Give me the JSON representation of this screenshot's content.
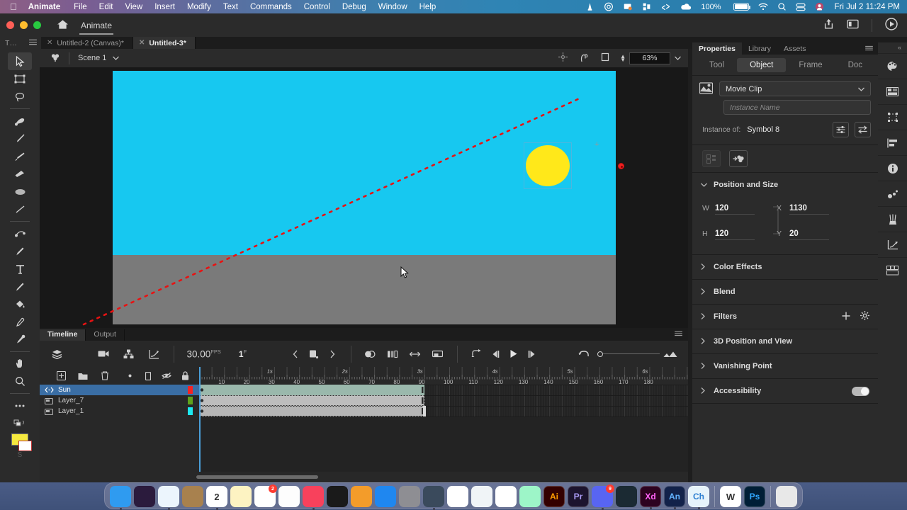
{
  "macbar": {
    "apple": "apple-logo",
    "menus": [
      "Animate",
      "File",
      "Edit",
      "View",
      "Insert",
      "Modify",
      "Text",
      "Commands",
      "Control",
      "Debug",
      "Window",
      "Help"
    ],
    "status_icons": [
      "vlc-icon",
      "creative-cloud-icon",
      "screenshot-icon",
      "shortcuts-icon",
      "dropbox-icon",
      "cloud-icon"
    ],
    "battery_percent": "100%",
    "right_icons": [
      "wifi-icon",
      "spotlight-icon",
      "control-center-icon",
      "user-icon"
    ],
    "clock": "Fri Jul 2  11:24 PM"
  },
  "titlebar": {
    "home_icon": "home-icon",
    "app_name": "Animate",
    "share_icon": "share-icon",
    "layout_icon": "workspace-icon",
    "play_icon": "test-movie-icon"
  },
  "doctabs": {
    "corner_label": "T…",
    "corner_menu": "hamburger-icon",
    "tabs": [
      {
        "label": "Untitled-2 (Canvas)*",
        "active": false
      },
      {
        "label": "Untitled-3*",
        "active": true
      }
    ]
  },
  "toolbar": {
    "tools": [
      {
        "name": "selection-tool",
        "selected": true
      },
      {
        "name": "free-transform-tool",
        "selected": false
      },
      {
        "name": "lasso-tool",
        "selected": false
      },
      {
        "name": "brush-tool",
        "selected": false
      },
      {
        "name": "paint-brush-tool",
        "selected": false
      },
      {
        "name": "fluid-brush-tool",
        "selected": false
      },
      {
        "name": "eraser-tool",
        "selected": false
      },
      {
        "name": "oval-tool",
        "selected": false
      },
      {
        "name": "line-tool",
        "selected": false
      },
      {
        "name": "bone-tool",
        "selected": false
      },
      {
        "name": "pen-tool",
        "selected": false
      },
      {
        "name": "text-tool",
        "selected": false
      },
      {
        "name": "pencil-tool",
        "selected": false
      },
      {
        "name": "paint-bucket-tool",
        "selected": false
      },
      {
        "name": "eyedropper-tool",
        "selected": false
      },
      {
        "name": "width-tool",
        "selected": false
      },
      {
        "name": "hand-tool",
        "selected": false
      },
      {
        "name": "zoom-tool",
        "selected": false
      },
      {
        "name": "more-tools-icon",
        "selected": false
      }
    ],
    "stroke_color": "#ffffff",
    "fill_color": "#f5e93f",
    "footer_label": "S"
  },
  "stagebar": {
    "scene_icon": "scene-icon",
    "scene_name": "Scene 1",
    "scene_chevron": "chevron-down-icon",
    "center_icon": "center-stage-icon",
    "rotate_icon": "rotation-icon",
    "fit_icon": "clip-content-icon",
    "zoom_value": "63%",
    "zoom_chevron": "chevron-down-icon"
  },
  "canvas": {
    "sky_color": "#17c8f0",
    "ground_color": "#7a7a7a",
    "sun_color": "#ffe81a",
    "motion_path_color": "#e81212",
    "registration_point": "registration-point-icon",
    "cursor": "pointer-cursor"
  },
  "timeline": {
    "panel_tabs": [
      {
        "label": "Timeline",
        "active": true
      },
      {
        "label": "Output",
        "active": false
      }
    ],
    "grip": "hamburger-icon",
    "tools_left": [
      "layer-depth-icon",
      "camera-icon",
      "parenting-view-icon",
      "motion-editor-icon"
    ],
    "fps": "30.00",
    "fps_suffix": "FPS",
    "current_frame": "1",
    "frame_suffix": "F",
    "transport": [
      "prev-keyframe-icon",
      "insert-keyframe-icon",
      "next-keyframe-icon",
      "onion-skin-icon",
      "onion-skin-outline-icon",
      "edit-multiple-frames-icon",
      "modify-onion-markers-icon",
      "loop-icon",
      "step-back-icon",
      "play-icon",
      "step-forward-icon"
    ],
    "loop_icon": "loop-playback-icon",
    "zoom_knob": "timeline-zoom-slider",
    "resize_icon": "frame-size-icon",
    "layer_tools": [
      "new-layer-icon",
      "new-folder-icon",
      "delete-layer-icon",
      "show-all-icon",
      "outline-icon",
      "hide-icon",
      "lock-icon"
    ],
    "layers": [
      {
        "name": "Sun",
        "color": "#f52222",
        "selected": true,
        "type": "tween-layer",
        "span_end_frame": 90
      },
      {
        "name": "Layer_7",
        "color": "#5fa31a",
        "selected": false,
        "type": "normal-layer",
        "span_end_frame": 90
      },
      {
        "name": "Layer_1",
        "color": "#1de8f0",
        "selected": false,
        "type": "normal-layer",
        "span_end_frame": 90
      }
    ],
    "ruler": {
      "second_labels": [
        "1s",
        "2s",
        "3s",
        "4s",
        "5s",
        "6s"
      ],
      "frame_labels": [
        "10",
        "20",
        "30",
        "40",
        "50",
        "60",
        "70",
        "80",
        "90",
        "100",
        "110",
        "120",
        "130",
        "140",
        "150",
        "160",
        "170",
        "180"
      ]
    },
    "playhead_frame": 1
  },
  "properties": {
    "panel_tabs": [
      {
        "label": "Properties",
        "active": true
      },
      {
        "label": "Library",
        "active": false
      },
      {
        "label": "Assets",
        "active": false
      }
    ],
    "grip": "hamburger-icon",
    "segments": [
      {
        "label": "Tool",
        "active": false
      },
      {
        "label": "Object",
        "active": true
      },
      {
        "label": "Frame",
        "active": false
      },
      {
        "label": "Doc",
        "active": false
      }
    ],
    "symbol_icon": "movie-clip-icon",
    "symbol_type": "Movie Clip",
    "symbol_chevron": "chevron-down-icon",
    "instance_name_placeholder": "Instance Name",
    "instance_of_label": "Instance of:",
    "instance_of_value": "Symbol 8",
    "instance_buttons": [
      "properties-sliders-icon",
      "swap-symbol-icon"
    ],
    "object_tools": [
      "distribute-icon",
      "apply-asset-icon"
    ],
    "sections": [
      {
        "title": "Position and Size",
        "expanded": true,
        "fields": [
          {
            "label": "W",
            "value": "120"
          },
          {
            "label": "X",
            "value": "1130"
          },
          {
            "label": "H",
            "value": "120"
          },
          {
            "label": "Y",
            "value": "20"
          }
        ],
        "lock_icon": "unlock-icon"
      },
      {
        "title": "Color Effects",
        "expanded": false
      },
      {
        "title": "Blend",
        "expanded": false
      },
      {
        "title": "Filters",
        "expanded": false,
        "actions": [
          "plus-icon",
          "gear-icon"
        ]
      },
      {
        "title": "3D Position and View",
        "expanded": false
      },
      {
        "title": "Vanishing Point",
        "expanded": false
      },
      {
        "title": "Accessibility",
        "expanded": false,
        "toggle": true
      }
    ]
  },
  "rail": {
    "collapse_icon": "collapse-panels-icon",
    "items": [
      "color-panel-icon",
      "library-panel-icon",
      "transform-panel-icon",
      "align-panel-icon",
      "info-panel-icon",
      "swatches-panel-icon",
      "brush-library-icon",
      "motion-editor-icon",
      "frame-picker-icon"
    ]
  },
  "dock": {
    "items": [
      {
        "name": "finder",
        "label": "",
        "color": "#2f9bf0"
      },
      {
        "name": "siri",
        "label": "",
        "color": "#2b1b3d"
      },
      {
        "name": "safari",
        "label": "",
        "color": "#ecf5fd"
      },
      {
        "name": "contacts",
        "label": "",
        "color": "#a8814e"
      },
      {
        "name": "calendar",
        "label": "2",
        "color": "#ffffff"
      },
      {
        "name": "notes",
        "label": "",
        "color": "#fdf3c2"
      },
      {
        "name": "reminders",
        "label": "",
        "color": "#ffffff",
        "badge": "2"
      },
      {
        "name": "photos",
        "label": "",
        "color": "#fdfdfd"
      },
      {
        "name": "music",
        "label": "",
        "color": "#f8415c"
      },
      {
        "name": "apple-tv",
        "label": "",
        "color": "#1a1a1a"
      },
      {
        "name": "books",
        "label": "",
        "color": "#f39c2a"
      },
      {
        "name": "app-store",
        "label": "",
        "color": "#1f87f0"
      },
      {
        "name": "system-preferences",
        "label": "",
        "color": "#8e8e93"
      },
      {
        "name": "vlc",
        "label": "",
        "color": "#3a4a5c"
      },
      {
        "name": "chrome",
        "label": "",
        "color": "#ffffff"
      },
      {
        "name": "sublime",
        "label": "",
        "color": "#f0f4f7"
      },
      {
        "name": "mediaplayer",
        "label": "",
        "color": "#ffffff"
      },
      {
        "name": "obs",
        "label": "",
        "color": "#9df5c8"
      },
      {
        "name": "illustrator",
        "label": "Ai",
        "color": "#330000"
      },
      {
        "name": "premiere",
        "label": "Pr",
        "color": "#1c142e"
      },
      {
        "name": "discord",
        "label": "",
        "color": "#5865f2",
        "badge": "9"
      },
      {
        "name": "adobe-xd-lib",
        "label": "",
        "color": "#1b2a33"
      },
      {
        "name": "adobe-xd",
        "label": "Xd",
        "color": "#2d0320"
      },
      {
        "name": "animate",
        "label": "An",
        "color": "#12224a"
      },
      {
        "name": "character-animator",
        "label": "Ch",
        "color": "#e6f3fb"
      },
      {
        "name": "word",
        "label": "W",
        "color": "#ffffff"
      },
      {
        "name": "photoshop",
        "label": "Ps",
        "color": "#001e36"
      },
      {
        "name": "trash",
        "label": "",
        "color": "#e8e8e8"
      }
    ]
  }
}
